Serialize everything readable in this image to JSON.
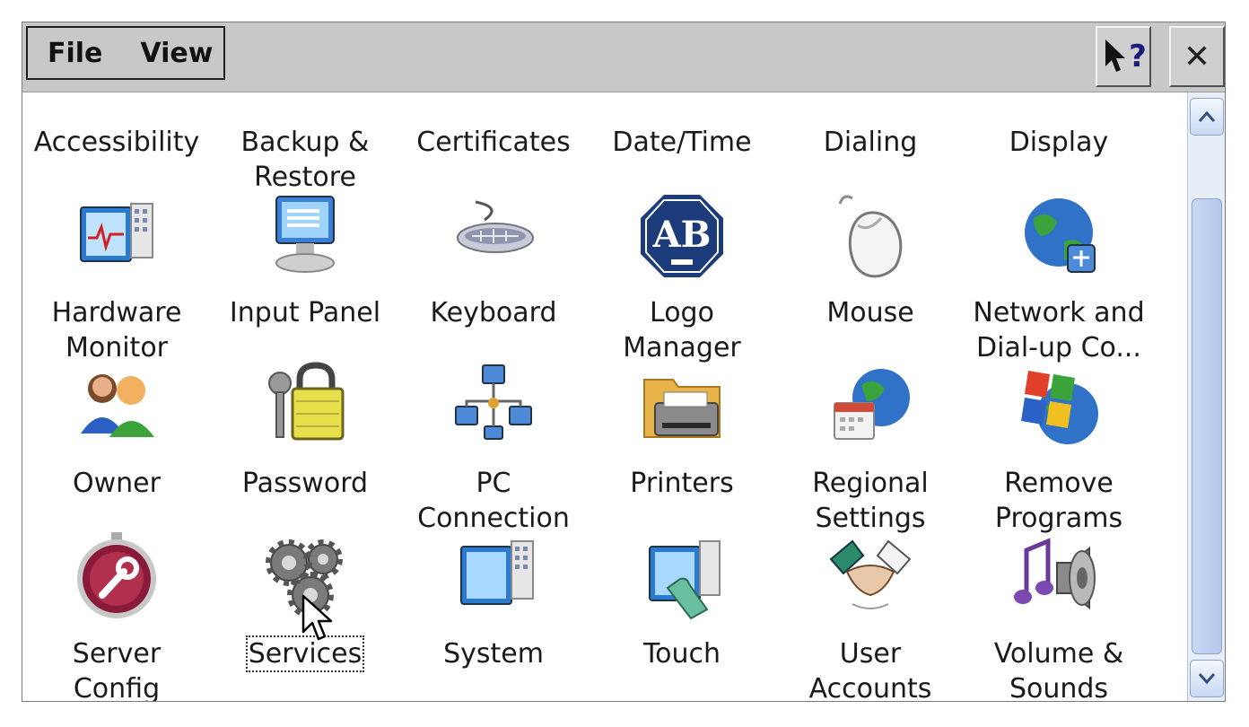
{
  "menu": {
    "file": "File",
    "view": "View"
  },
  "titlebar": {
    "help_label": "?",
    "close_label": "✕"
  },
  "items": [
    {
      "label": "Accessibility",
      "icon": "accessibility-icon"
    },
    {
      "label": "Backup &\nRestore",
      "icon": "backup-icon"
    },
    {
      "label": "Certificates",
      "icon": "certificates-icon"
    },
    {
      "label": "Date/Time",
      "icon": "datetime-icon"
    },
    {
      "label": "Dialing",
      "icon": "dialing-icon"
    },
    {
      "label": "Display",
      "icon": "display-icon"
    },
    {
      "label": "Hardware\nMonitor",
      "icon": "hardware-monitor-icon"
    },
    {
      "label": "Input Panel",
      "icon": "input-panel-icon"
    },
    {
      "label": "Keyboard",
      "icon": "keyboard-icon"
    },
    {
      "label": "Logo\nManager",
      "icon": "logo-manager-icon"
    },
    {
      "label": "Mouse",
      "icon": "mouse-icon"
    },
    {
      "label": "Network and\nDial-up Co...",
      "icon": "network-icon"
    },
    {
      "label": "Owner",
      "icon": "owner-icon"
    },
    {
      "label": "Password",
      "icon": "password-icon"
    },
    {
      "label": "PC\nConnection",
      "icon": "pc-connection-icon"
    },
    {
      "label": "Printers",
      "icon": "printers-icon"
    },
    {
      "label": "Regional\nSettings",
      "icon": "regional-settings-icon"
    },
    {
      "label": "Remove\nPrograms",
      "icon": "remove-programs-icon"
    },
    {
      "label": "Server\nConfig",
      "icon": "server-config-icon"
    },
    {
      "label": "Services",
      "icon": "services-icon"
    },
    {
      "label": "System",
      "icon": "system-icon"
    },
    {
      "label": "Touch",
      "icon": "touch-icon"
    },
    {
      "label": "User\nAccounts",
      "icon": "user-accounts-icon"
    },
    {
      "label": "Volume &\nSounds",
      "icon": "volume-sounds-icon"
    }
  ],
  "logo_text": "AB",
  "selected_item": "Services",
  "colors": {
    "titlebar": "#c8c8c8",
    "scrollbar_thumb": "#b5c9ee",
    "logo_blue": "#1b3b7a"
  }
}
